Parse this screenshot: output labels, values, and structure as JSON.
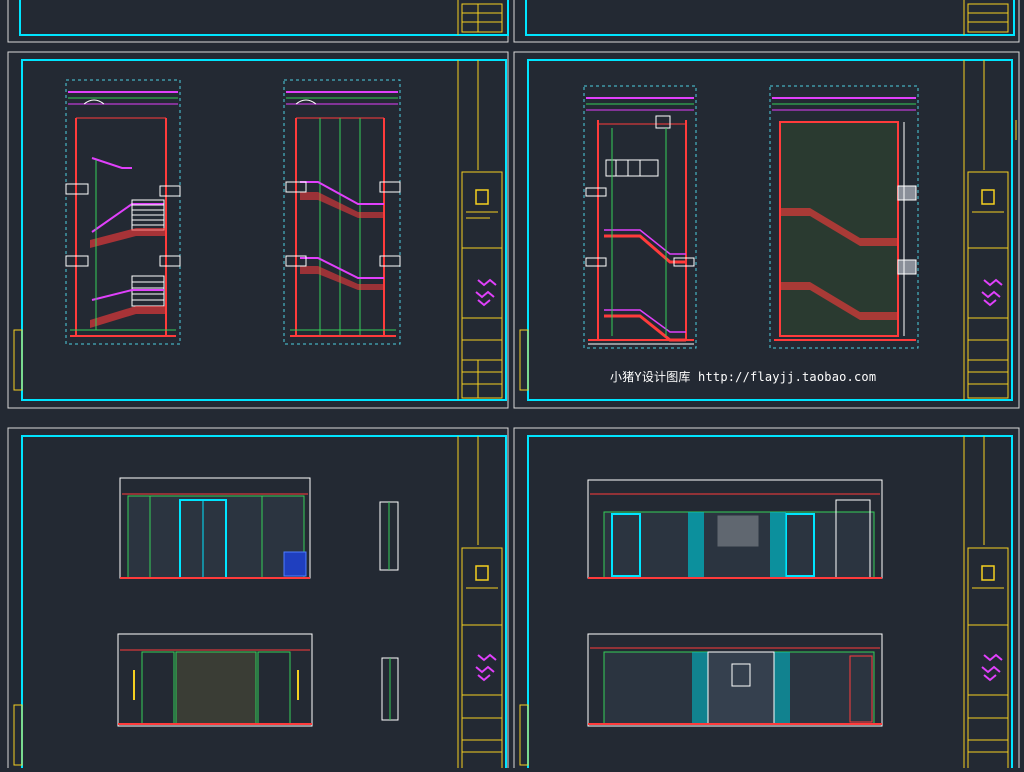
{
  "image_kind": "CAD architectural elevation drawing sheets (stair sections and wall elevations)",
  "colors": {
    "background": "#232933",
    "frame": "#00e5ff",
    "title_block_text": "#f5d020",
    "wall": "#ff3b3b",
    "stair_rail": "#e040fb",
    "partition": "#34d058",
    "dim_dashed": "#4dd0e1",
    "glass": "#7df9ff",
    "white": "#ffffff"
  },
  "caption": "小猪Y设计图库 http://flayjj.taobao.com",
  "sheets": [
    {
      "label": "sheet-top-left-partial"
    },
    {
      "label": "sheet-top-right-partial"
    },
    {
      "label": "sheet-stair-sections-a"
    },
    {
      "label": "sheet-stair-sections-b"
    },
    {
      "label": "sheet-wall-elevations-a"
    },
    {
      "label": "sheet-wall-elevations-b"
    }
  ]
}
